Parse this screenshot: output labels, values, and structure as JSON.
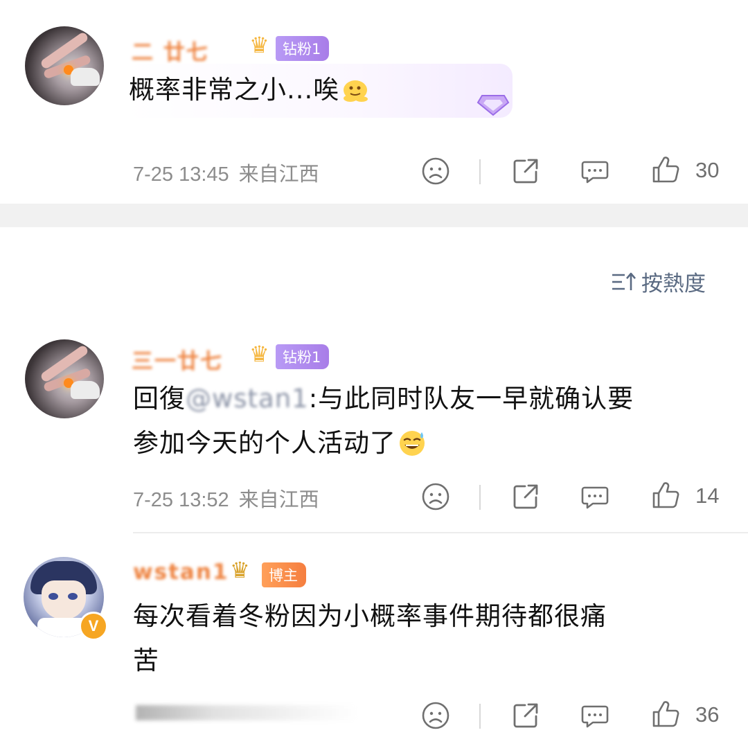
{
  "comments": [
    {
      "username": "二 廿七",
      "badge": "钻粉1",
      "text": "概率非常之小...唉",
      "time": "7-25 13:45",
      "location": "来自江西",
      "likes": "30"
    },
    {
      "username": "三一廿七",
      "badge": "钻粉1",
      "reply_prefix": "回復",
      "reply_handle": "@wstan1",
      "reply_text": ":与此同时队友一早就确认要",
      "reply_text_2": "参加今天的个人活动了",
      "time": "7-25 13:52",
      "location": "来自江西",
      "likes": "14"
    },
    {
      "username": "wstan1",
      "badge": "博主",
      "verified_mark": "V",
      "text_line1": "每次看着冬粉因为小概率事件期待都很痛",
      "text_line2": "苦",
      "likes": "36"
    }
  ],
  "sort": {
    "icon": "sort-icon",
    "label": "按熱度"
  },
  "icons": {
    "dislike": "sad-face-icon",
    "share": "share-icon",
    "reply": "comment-bubble-icon",
    "like": "thumbs-up-icon"
  },
  "colors": {
    "username": "#ee8340",
    "fan_badge": "#b08af0",
    "blogger_badge": "#f68648",
    "meta": "#8c8c8c",
    "sort": "#5a6a82"
  }
}
